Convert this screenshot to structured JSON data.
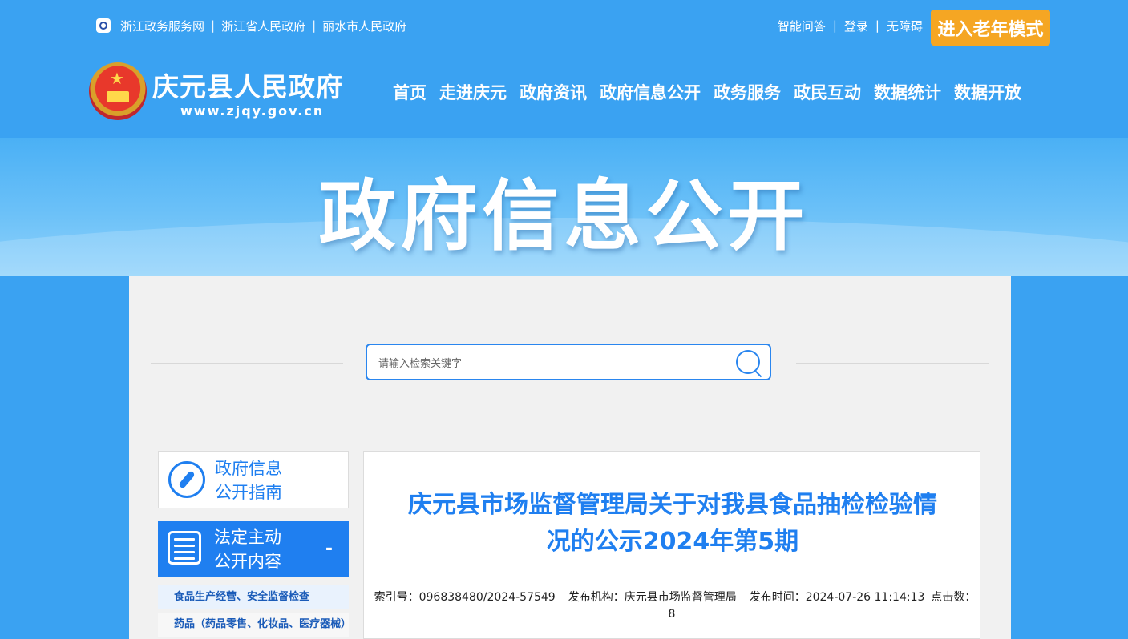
{
  "header": {
    "top_links": [
      "浙江政务服务网",
      "浙江省人民政府",
      "丽水市人民政府"
    ],
    "right_links": [
      "智能问答",
      "登录",
      "无障碍"
    ],
    "elder_mode": "进入老年模式",
    "site_title": "庆元县人民政府",
    "site_url": "www.zjqy.gov.cn",
    "nav": [
      "首页",
      "走进庆元",
      "政府资讯",
      "政府信息公开",
      "政务服务",
      "政民互动",
      "数据统计",
      "数据开放"
    ]
  },
  "banner": {
    "title": "政府信息公开"
  },
  "search": {
    "placeholder": "请输入检索关键字"
  },
  "sidebar": {
    "guide": {
      "line1": "政府信息",
      "line2": "公开指南"
    },
    "active": {
      "line1": "法定主动",
      "line2": "公开内容",
      "toggle": "-"
    },
    "items": [
      "食品生产经营、安全监督检查",
      "药品（药品零售、化妆品、医疗器械）"
    ]
  },
  "article": {
    "title_line1": "庆元县市场监督管理局关于对我县食品抽检检验情",
    "title_line2": "况的公示2024年第5期",
    "index_no": "索引号：096838480/2024-57549",
    "publisher": "发布机构：庆元县市场监督管理局",
    "publish_time": "发布时间：2024-07-26 11:14:13",
    "clicks": "点击数：8"
  },
  "colors": {
    "header_bg": "#3aa2f2",
    "accent": "#1f7ff0",
    "elder_btn": "#f5a623"
  }
}
